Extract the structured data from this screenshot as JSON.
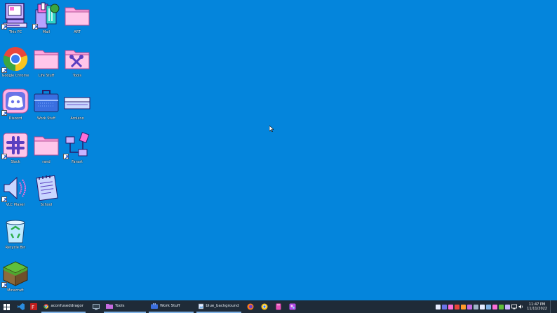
{
  "desktop": {
    "background": "#0485dc",
    "icons": [
      {
        "label": "This PC"
      },
      {
        "label": "Mail"
      },
      {
        "label": "ART"
      },
      {
        "label": "Google Chrome"
      },
      {
        "label": "Life Stuff"
      },
      {
        "label": "Tools"
      },
      {
        "label": "Discord"
      },
      {
        "label": "Work Stuff"
      },
      {
        "label": "Arduino"
      },
      {
        "label": "Slack"
      },
      {
        "label": "rand"
      },
      {
        "label": "Fanart"
      },
      {
        "label": "VLC Player"
      },
      {
        "label": "School"
      },
      {
        "label": "Recycle Bin"
      },
      {
        "label": "Minecraft"
      }
    ]
  },
  "taskbar": {
    "background": "#1f2b38",
    "accent": "#7fb2e6",
    "tasks": {
      "chrome": "aconfuseddragon (...",
      "tools": "Tools",
      "work": "Work Stuff",
      "blue": "blue_background.p..."
    },
    "clock": {
      "time": "11:47 PM",
      "date": "11/11/2022"
    }
  }
}
